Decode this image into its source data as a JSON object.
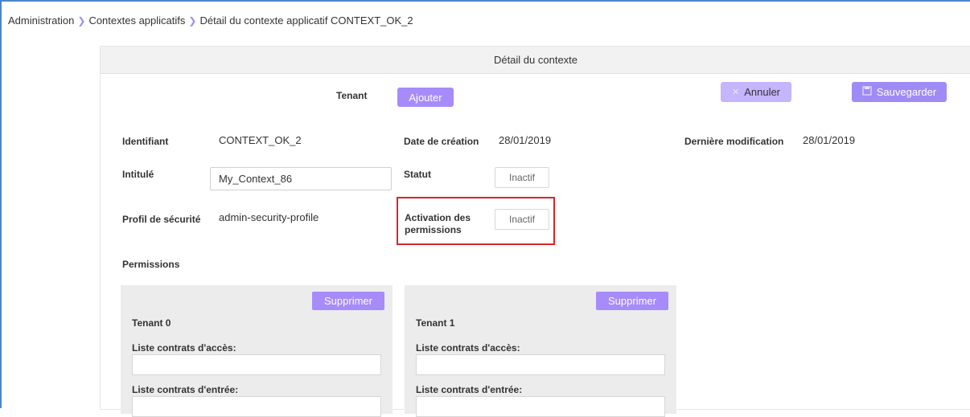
{
  "breadcrumb": {
    "items": [
      "Administration",
      "Contextes applicatifs",
      "Détail du contexte applicatif CONTEXT_OK_2"
    ]
  },
  "panel": {
    "title": "Détail du contexte"
  },
  "toolbar": {
    "tenant_label": "Tenant",
    "tenant_selected": "",
    "add_label": "Ajouter",
    "cancel_label": "Annuler",
    "save_label": "Sauvegarder"
  },
  "fields": {
    "identifiant_label": "Identifiant",
    "identifiant_value": "CONTEXT_OK_2",
    "date_creation_label": "Date de création",
    "date_creation_value": "28/01/2019",
    "derniere_modif_label": "Dernière modification",
    "derniere_modif_value": "28/01/2019",
    "intitule_label": "Intitulé",
    "intitule_value": "My_Context_86",
    "statut_label": "Statut",
    "statut_value": "Inactif",
    "profil_label": "Profil de sécurité",
    "profil_value": "admin-security-profile",
    "activation_label_line1": "Activation des",
    "activation_label_line2": "permissions",
    "activation_value": "Inactif",
    "permissions_label": "Permissions"
  },
  "permissions": [
    {
      "title": "Tenant 0",
      "delete_label": "Supprimer",
      "access_label": "Liste contrats d'accès:",
      "access_value": "",
      "entry_label": "Liste contrats d'entrée:",
      "entry_value": ""
    },
    {
      "title": "Tenant 1",
      "delete_label": "Supprimer",
      "access_label": "Liste contrats d'accès:",
      "access_value": "",
      "entry_label": "Liste contrats d'entrée:",
      "entry_value": ""
    }
  ],
  "colors": {
    "accent": "#a78bfa",
    "highlight": "#d6262a"
  },
  "icons": {
    "cancel": "close-icon",
    "save": "save-icon",
    "separator": "chevron-right-icon",
    "dropdown": "caret-down-icon"
  }
}
